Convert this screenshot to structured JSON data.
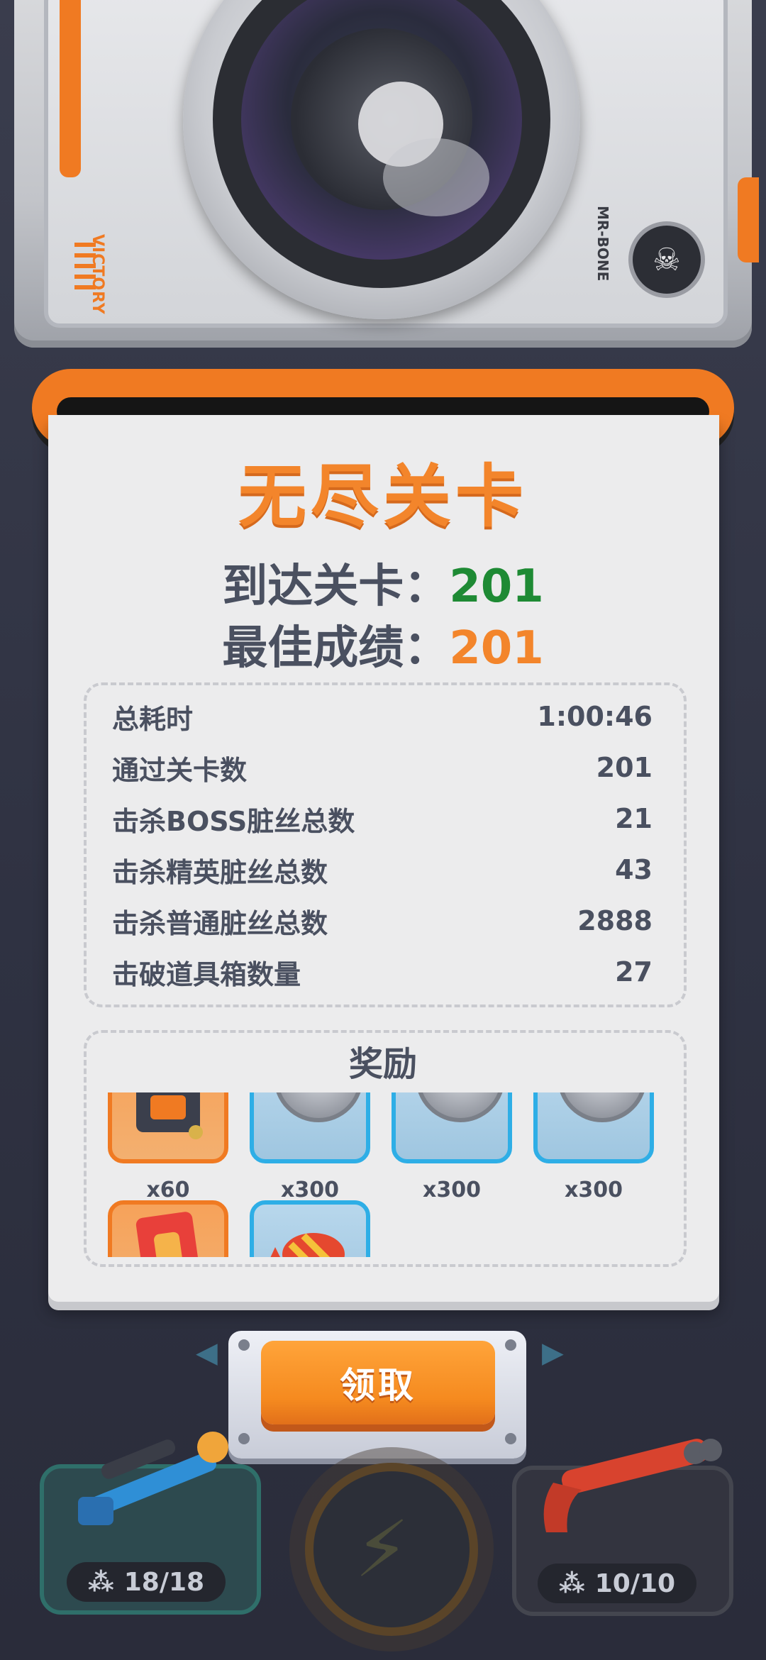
{
  "camera": {
    "brand": "VICTORY",
    "model": "MR-BONE"
  },
  "receipt": {
    "title": "无尽关卡",
    "reached_label": "到达关卡：",
    "reached_value": "201",
    "best_label": "最佳成绩：",
    "best_value": "201",
    "stats": [
      {
        "label": "总耗时",
        "value": "1:00:46"
      },
      {
        "label": "通过关卡数",
        "value": "201"
      },
      {
        "label": "击杀BOSS脏丝总数",
        "value": "21"
      },
      {
        "label": "击杀精英脏丝总数",
        "value": "43"
      },
      {
        "label": "击杀普通脏丝总数",
        "value": "2888"
      },
      {
        "label": "击破道具箱数量",
        "value": "27"
      }
    ],
    "rewards_title": "奖励",
    "rewards": [
      {
        "count": "x60",
        "frame": "orange",
        "icon": "gear-chip-icon"
      },
      {
        "count": "x300",
        "frame": "blue",
        "icon": "red-gem-coin-icon",
        "gem_color": "#e25a3a"
      },
      {
        "count": "x300",
        "frame": "blue",
        "icon": "blue-gem-coin-icon",
        "gem_color": "#3b7de0"
      },
      {
        "count": "x300",
        "frame": "blue",
        "icon": "green-gem-coin-icon",
        "gem_color": "#3cc24a"
      },
      {
        "count": "",
        "frame": "orange",
        "icon": "card-icon"
      },
      {
        "count": "",
        "frame": "blue",
        "icon": "candy-icon"
      }
    ]
  },
  "claim_button": {
    "label": "领取"
  },
  "weapons": {
    "left": {
      "ammo": "18/18",
      "icon": "sniper-rifle-icon"
    },
    "right": {
      "ammo": "10/10",
      "icon": "shotgun-icon"
    }
  },
  "colors": {
    "accent": "#f3852b",
    "green": "#1e8a34",
    "text": "#4a5060"
  }
}
